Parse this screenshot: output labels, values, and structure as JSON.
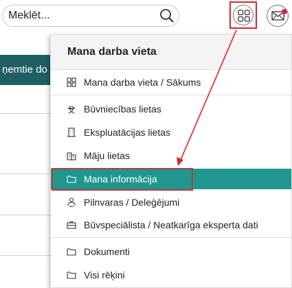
{
  "search": {
    "placeholder": "Meklēt..."
  },
  "background": {
    "tab_label": "ņemtie do"
  },
  "menu": {
    "title": "Mana darba vieta",
    "items": [
      {
        "label": "Mana darba vieta / Sākums",
        "icon": "grid-icon"
      },
      {
        "label": "Būvniecības lietas",
        "icon": "worker-icon"
      },
      {
        "label": "Ekspluatācijas lietas",
        "icon": "building-icon"
      },
      {
        "label": "Māju lietas",
        "icon": "houses-icon"
      },
      {
        "label": "Mana informācija",
        "icon": "folder-icon",
        "active": true
      },
      {
        "label": "Pilnvaras / Deleģējumi",
        "icon": "delegate-icon"
      },
      {
        "label": "Būvspeciālista / Neatkarīga eksperta dati",
        "icon": "briefcase-icon"
      },
      {
        "label": "Dokumenti",
        "icon": "folder-icon"
      },
      {
        "label": "Visi rēķini",
        "icon": "folder-icon"
      }
    ]
  },
  "colors": {
    "accent": "#20978e",
    "highlight": "#d9262c",
    "dark_tab": "#1f5e63"
  }
}
